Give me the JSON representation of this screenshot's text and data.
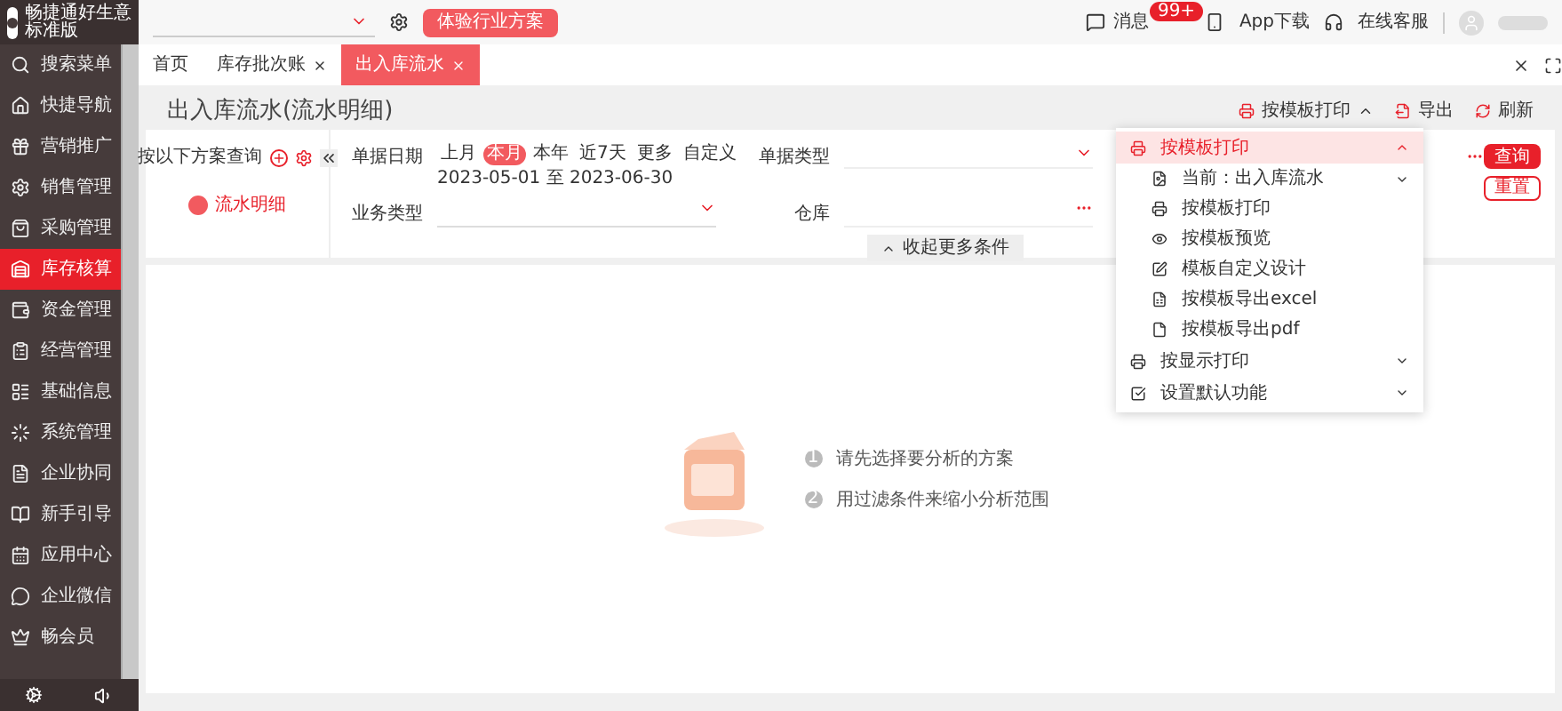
{
  "app": {
    "logo_text": "畅捷通好生意",
    "edition": "标准版"
  },
  "sidebar": {
    "items": [
      {
        "label": "搜索菜单",
        "selected": false
      },
      {
        "label": "快捷导航",
        "selected": false
      },
      {
        "label": "营销推广",
        "selected": false
      },
      {
        "label": "销售管理",
        "selected": false
      },
      {
        "label": "采购管理",
        "selected": false
      },
      {
        "label": "库存核算",
        "selected": true
      },
      {
        "label": "资金管理",
        "selected": false
      },
      {
        "label": "经营管理",
        "selected": false
      },
      {
        "label": "基础信息",
        "selected": false
      },
      {
        "label": "系统管理",
        "selected": false
      },
      {
        "label": "企业协同",
        "selected": false
      },
      {
        "label": "新手引导",
        "selected": false
      },
      {
        "label": "应用中心",
        "selected": false
      },
      {
        "label": "企业微信",
        "selected": false
      },
      {
        "label": "畅会员",
        "selected": false
      }
    ]
  },
  "header": {
    "trial_button": "体验行业方案",
    "messages": {
      "label": "消息",
      "badge": "99+"
    },
    "app_download": "App下载",
    "support": "在线客服"
  },
  "tabs": [
    {
      "label": "首页",
      "closable": false,
      "selected": false
    },
    {
      "label": "库存批次账",
      "closable": true,
      "selected": false
    },
    {
      "label": "出入库流水",
      "closable": true,
      "selected": true
    }
  ],
  "page": {
    "title": "出入库流水(流水明细)",
    "toolbar": [
      "按模板打印",
      "导出",
      "刷新"
    ]
  },
  "schemes": {
    "title": "按以下方案查询",
    "items": [
      "流水明细"
    ]
  },
  "filters": {
    "date": {
      "label": "单据日期",
      "options": [
        {
          "label": "上月",
          "selected": false
        },
        {
          "label": "本月",
          "selected": true
        },
        {
          "label": "本年",
          "selected": false
        },
        {
          "label": "近7天",
          "selected": false
        },
        {
          "label": "更多",
          "selected": false
        },
        {
          "label": "自定义",
          "selected": false
        }
      ],
      "range": "2023-05-01 至 2023-06-30"
    },
    "doc_type": {
      "label": "单据类型"
    },
    "biz_type": {
      "label": "业务类型"
    },
    "warehouse": {
      "label": "仓库"
    },
    "collapse": "收起更多条件",
    "query": "查询",
    "reset": "重置"
  },
  "print_menu": {
    "sections": [
      {
        "label": "按模板打印",
        "expanded": true,
        "children": [
          {
            "label": "当前：出入库流水",
            "kind": "select"
          },
          {
            "label": "按模板打印",
            "kind": "action"
          },
          {
            "label": "按模板预览",
            "kind": "action"
          },
          {
            "label": "模板自定义设计",
            "kind": "action"
          },
          {
            "label": "按模板导出excel",
            "kind": "action"
          },
          {
            "label": "按模板导出pdf",
            "kind": "action"
          }
        ]
      },
      {
        "label": "按显示打印",
        "expanded": false
      },
      {
        "label": "设置默认功能",
        "expanded": false
      }
    ]
  },
  "empty_state": {
    "steps": [
      {
        "number": "1",
        "text": "请先选择要分析的方案"
      },
      {
        "number": "2",
        "text": "用过滤条件来缩小分析范围"
      }
    ]
  }
}
